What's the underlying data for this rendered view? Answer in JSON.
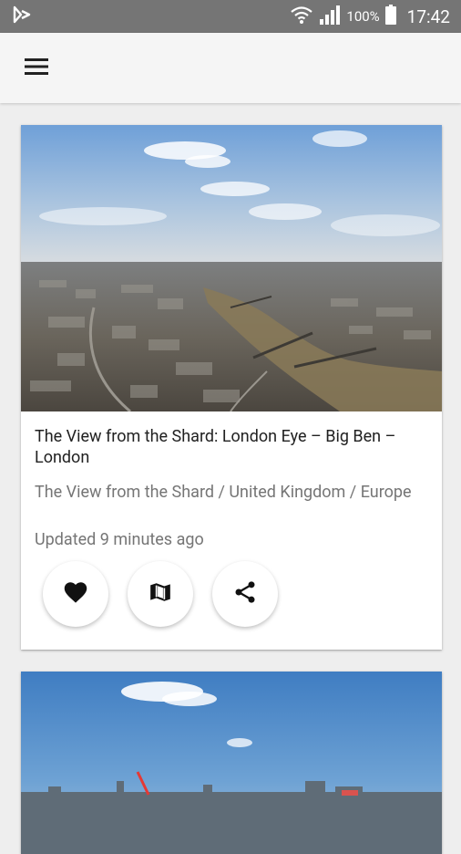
{
  "status_bar": {
    "battery": "100%",
    "time": "17:42"
  },
  "app_bar": {
    "menu_icon": "hamburger-menu-icon"
  },
  "cards": [
    {
      "title": "The View from the Shard: London Eye – Big Ben – London",
      "location": "The View from the Shard / United Kingdom / Europe",
      "updated": "Updated 9 minutes ago",
      "actions": [
        "favorite-heart-icon",
        "map-icon",
        "share-icon"
      ]
    }
  ],
  "colors": {
    "status_bar_bg": "#757575",
    "app_bar_bg": "#f5f5f5",
    "page_bg": "#eeeeee",
    "title_text": "#212121",
    "secondary_text": "#757575"
  }
}
